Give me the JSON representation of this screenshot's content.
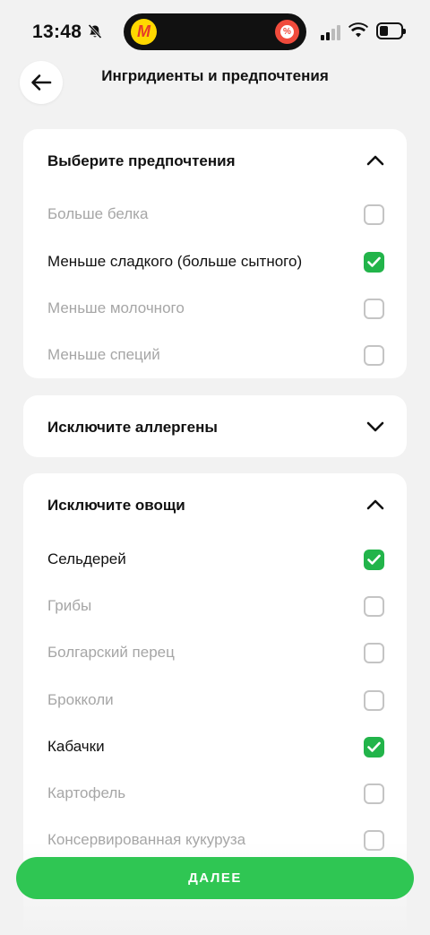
{
  "status_bar": {
    "time": "13:48",
    "app_badge_letter": "M",
    "promo_badge_symbol": "%"
  },
  "header": {
    "title": "Ингридиенты и предпочтения"
  },
  "preferences_section": {
    "title": "Выберите предпочтения",
    "expanded": true,
    "options": [
      {
        "label": "Больше белка",
        "checked": false
      },
      {
        "label": "Меньше сладкого (больше сытного)",
        "checked": true
      },
      {
        "label": "Меньше молочного",
        "checked": false
      },
      {
        "label": "Меньше специй",
        "checked": false
      }
    ]
  },
  "allergens_section": {
    "title": "Исключите аллергены",
    "expanded": false
  },
  "vegetables_section": {
    "title": "Исключите овощи",
    "expanded": true,
    "options": [
      {
        "label": "Сельдерей",
        "checked": true
      },
      {
        "label": "Грибы",
        "checked": false
      },
      {
        "label": "Болгарский перец",
        "checked": false
      },
      {
        "label": "Брокколи",
        "checked": false
      },
      {
        "label": "Кабачки",
        "checked": true
      },
      {
        "label": "Картофель",
        "checked": false
      },
      {
        "label": "Консервированная кукуруза",
        "checked": false
      }
    ]
  },
  "footer": {
    "next_label": "ДАЛЕЕ"
  },
  "colors": {
    "accent_green": "#2fc653",
    "checkbox_green": "#22b44a",
    "background": "#f2f2f2"
  }
}
